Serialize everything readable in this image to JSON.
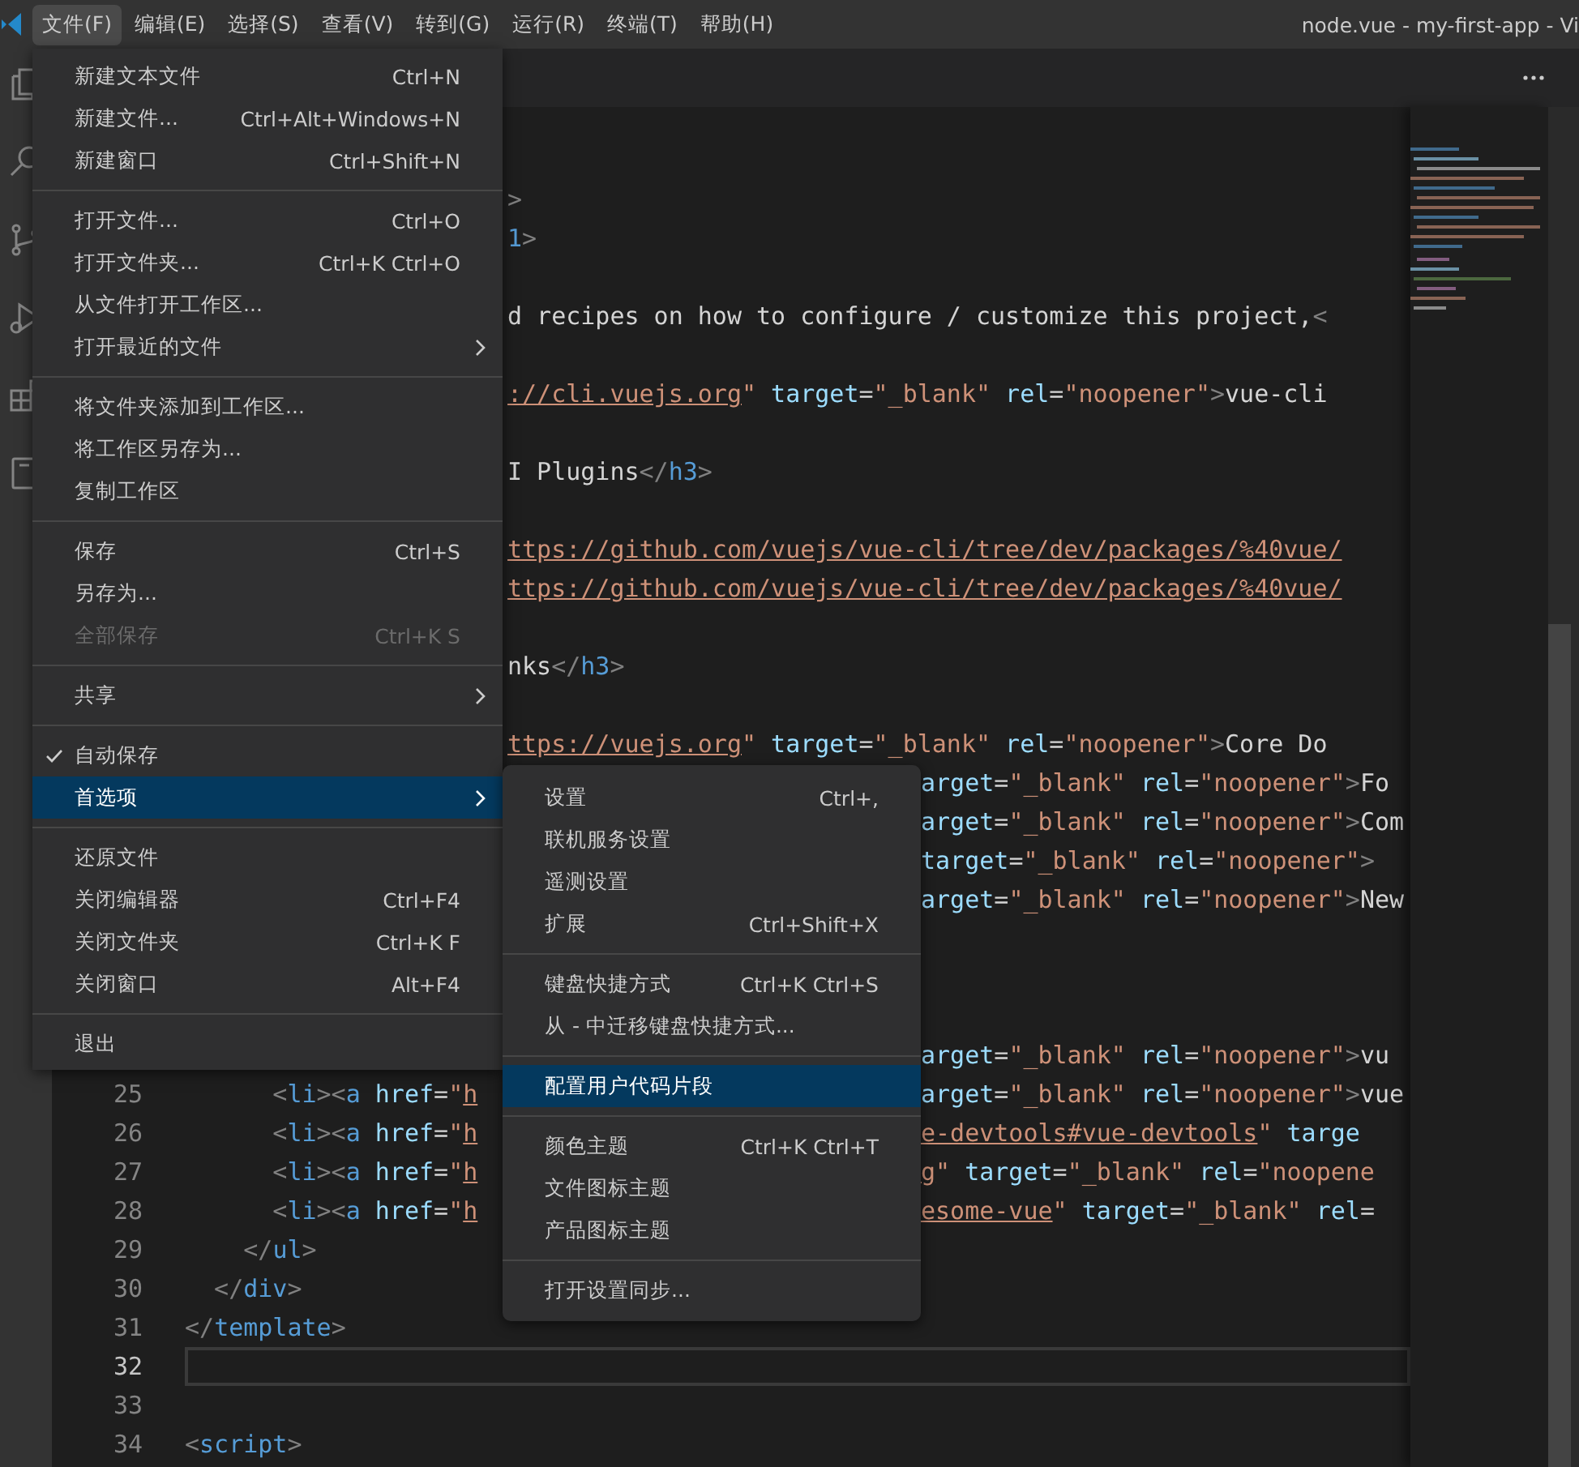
{
  "menu_bar": {
    "items": [
      {
        "label": "文件(F)",
        "selected": true
      },
      {
        "label": "编辑(E)",
        "selected": false
      },
      {
        "label": "选择(S)",
        "selected": false
      },
      {
        "label": "查看(V)",
        "selected": false
      },
      {
        "label": "转到(G)",
        "selected": false
      },
      {
        "label": "运行(R)",
        "selected": false
      },
      {
        "label": "终端(T)",
        "selected": false
      },
      {
        "label": "帮助(H)",
        "selected": false
      }
    ]
  },
  "window_title": "node.vue - my-first-app - Vi",
  "file_menu": {
    "items": [
      {
        "kind": "item",
        "label": "新建文本文件",
        "shortcut": "Ctrl+N",
        "has_submenu": false,
        "checked": false,
        "disabled": false,
        "selected": false
      },
      {
        "kind": "item",
        "label": "新建文件...",
        "shortcut": "Ctrl+Alt+Windows+N",
        "has_submenu": false,
        "checked": false,
        "disabled": false,
        "selected": false
      },
      {
        "kind": "item",
        "label": "新建窗口",
        "shortcut": "Ctrl+Shift+N",
        "has_submenu": false,
        "checked": false,
        "disabled": false,
        "selected": false
      },
      {
        "kind": "separator"
      },
      {
        "kind": "item",
        "label": "打开文件...",
        "shortcut": "Ctrl+O",
        "has_submenu": false,
        "checked": false,
        "disabled": false,
        "selected": false
      },
      {
        "kind": "item",
        "label": "打开文件夹...",
        "shortcut": "Ctrl+K Ctrl+O",
        "has_submenu": false,
        "checked": false,
        "disabled": false,
        "selected": false
      },
      {
        "kind": "item",
        "label": "从文件打开工作区...",
        "has_submenu": false,
        "checked": false,
        "disabled": false,
        "selected": false
      },
      {
        "kind": "item",
        "label": "打开最近的文件",
        "has_submenu": true,
        "checked": false,
        "disabled": false,
        "selected": false
      },
      {
        "kind": "separator"
      },
      {
        "kind": "item",
        "label": "将文件夹添加到工作区...",
        "has_submenu": false,
        "checked": false,
        "disabled": false,
        "selected": false
      },
      {
        "kind": "item",
        "label": "将工作区另存为...",
        "has_submenu": false,
        "checked": false,
        "disabled": false,
        "selected": false
      },
      {
        "kind": "item",
        "label": "复制工作区",
        "has_submenu": false,
        "checked": false,
        "disabled": false,
        "selected": false
      },
      {
        "kind": "separator"
      },
      {
        "kind": "item",
        "label": "保存",
        "shortcut": "Ctrl+S",
        "has_submenu": false,
        "checked": false,
        "disabled": false,
        "selected": false
      },
      {
        "kind": "item",
        "label": "另存为...",
        "has_submenu": false,
        "checked": false,
        "disabled": false,
        "selected": false
      },
      {
        "kind": "item",
        "label": "全部保存",
        "shortcut": "Ctrl+K S",
        "has_submenu": false,
        "checked": false,
        "disabled": true,
        "selected": false
      },
      {
        "kind": "separator"
      },
      {
        "kind": "item",
        "label": "共享",
        "has_submenu": true,
        "checked": false,
        "disabled": false,
        "selected": false
      },
      {
        "kind": "separator"
      },
      {
        "kind": "item",
        "label": "自动保存",
        "has_submenu": false,
        "checked": true,
        "disabled": false,
        "selected": false
      },
      {
        "kind": "item",
        "label": "首选项",
        "has_submenu": true,
        "checked": false,
        "disabled": false,
        "selected": true
      },
      {
        "kind": "separator"
      },
      {
        "kind": "item",
        "label": "还原文件",
        "has_submenu": false,
        "checked": false,
        "disabled": false,
        "selected": false
      },
      {
        "kind": "item",
        "label": "关闭编辑器",
        "shortcut": "Ctrl+F4",
        "has_submenu": false,
        "checked": false,
        "disabled": false,
        "selected": false
      },
      {
        "kind": "item",
        "label": "关闭文件夹",
        "shortcut": "Ctrl+K F",
        "has_submenu": false,
        "checked": false,
        "disabled": false,
        "selected": false
      },
      {
        "kind": "item",
        "label": "关闭窗口",
        "shortcut": "Alt+F4",
        "has_submenu": false,
        "checked": false,
        "disabled": false,
        "selected": false
      },
      {
        "kind": "separator"
      },
      {
        "kind": "item",
        "label": "退出",
        "has_submenu": false,
        "checked": false,
        "disabled": false,
        "selected": false
      }
    ]
  },
  "preferences_submenu": {
    "items": [
      {
        "kind": "item",
        "label": "设置",
        "shortcut": "Ctrl+,",
        "has_submenu": false,
        "checked": false,
        "disabled": false,
        "selected": false
      },
      {
        "kind": "item",
        "label": "联机服务设置",
        "has_submenu": false,
        "checked": false,
        "disabled": false,
        "selected": false
      },
      {
        "kind": "item",
        "label": "遥测设置",
        "has_submenu": false,
        "checked": false,
        "disabled": false,
        "selected": false
      },
      {
        "kind": "item",
        "label": "扩展",
        "shortcut": "Ctrl+Shift+X",
        "has_submenu": false,
        "checked": false,
        "disabled": false,
        "selected": false
      },
      {
        "kind": "separator"
      },
      {
        "kind": "item",
        "label": "键盘快捷方式",
        "shortcut": "Ctrl+K Ctrl+S",
        "has_submenu": false,
        "checked": false,
        "disabled": false,
        "selected": false
      },
      {
        "kind": "item",
        "label": "从 - 中迁移键盘快捷方式...",
        "has_submenu": false,
        "checked": false,
        "disabled": false,
        "selected": false
      },
      {
        "kind": "separator"
      },
      {
        "kind": "item",
        "label": "配置用户代码片段",
        "has_submenu": false,
        "checked": false,
        "disabled": false,
        "selected": true
      },
      {
        "kind": "separator"
      },
      {
        "kind": "item",
        "label": "颜色主题",
        "shortcut": "Ctrl+K Ctrl+T",
        "has_submenu": false,
        "checked": false,
        "disabled": false,
        "selected": false
      },
      {
        "kind": "item",
        "label": "文件图标主题",
        "has_submenu": false,
        "checked": false,
        "disabled": false,
        "selected": false
      },
      {
        "kind": "item",
        "label": "产品图标主题",
        "has_submenu": false,
        "checked": false,
        "disabled": false,
        "selected": false
      },
      {
        "kind": "separator"
      },
      {
        "kind": "item",
        "label": "打开设置同步...",
        "has_submenu": false,
        "checked": false,
        "disabled": false,
        "selected": false
      }
    ]
  },
  "editor": {
    "lines": [
      {
        "current": false
      },
      {
        "current": false,
        "left": [
          {
            "kind": "punct",
            "text": ">"
          }
        ]
      },
      {
        "current": false,
        "left": [
          {
            "kind": "tag",
            "text": "1"
          },
          {
            "kind": "punct",
            "text": ">"
          }
        ]
      },
      {
        "current": false
      },
      {
        "current": false,
        "left": [
          {
            "kind": "text",
            "text": "d recipes on how to configure / customize this project,"
          },
          {
            "kind": "punct",
            "text": "<"
          }
        ]
      },
      {
        "current": false
      },
      {
        "current": false,
        "left": [
          {
            "kind": "link",
            "text": "://cli.vuejs.org"
          },
          {
            "kind": "string",
            "text": "\""
          },
          {
            "kind": "attr",
            "text": " target"
          },
          {
            "kind": "text",
            "text": "="
          },
          {
            "kind": "string",
            "text": "\"_blank\""
          },
          {
            "kind": "attr",
            "text": " rel"
          },
          {
            "kind": "text",
            "text": "="
          },
          {
            "kind": "string",
            "text": "\"noopener\""
          },
          {
            "kind": "punct",
            "text": ">"
          },
          {
            "kind": "text",
            "text": "vue-cli"
          }
        ]
      },
      {
        "current": false
      },
      {
        "current": false,
        "left": [
          {
            "kind": "text",
            "text": "I Plugins"
          },
          {
            "kind": "punct",
            "text": "</"
          },
          {
            "kind": "tag",
            "text": "h3"
          },
          {
            "kind": "punct",
            "text": ">"
          }
        ]
      },
      {
        "current": false
      },
      {
        "current": false,
        "left": [
          {
            "kind": "link",
            "text": "ttps://github.com/vuejs/vue-cli/tree/dev/packages/%40vue/"
          }
        ]
      },
      {
        "current": false,
        "left": [
          {
            "kind": "link",
            "text": "ttps://github.com/vuejs/vue-cli/tree/dev/packages/%40vue/"
          }
        ]
      },
      {
        "current": false
      },
      {
        "current": false,
        "left": [
          {
            "kind": "text",
            "text": "nks"
          },
          {
            "kind": "punct",
            "text": "</"
          },
          {
            "kind": "tag",
            "text": "h3"
          },
          {
            "kind": "punct",
            "text": ">"
          }
        ]
      },
      {
        "current": false
      },
      {
        "current": false,
        "left": [
          {
            "kind": "link",
            "text": "ttps://vuejs.org"
          },
          {
            "kind": "string",
            "text": "\""
          },
          {
            "kind": "attr",
            "text": " target"
          },
          {
            "kind": "text",
            "text": "="
          },
          {
            "kind": "string",
            "text": "\"_blank\""
          },
          {
            "kind": "attr",
            "text": " rel"
          },
          {
            "kind": "text",
            "text": "="
          },
          {
            "kind": "string",
            "text": "\"noopener\""
          },
          {
            "kind": "punct",
            "text": ">"
          },
          {
            "kind": "text",
            "text": "Core Do"
          }
        ]
      },
      {
        "current": false,
        "right": [
          {
            "kind": "attr",
            "text": "arget"
          },
          {
            "kind": "text",
            "text": "="
          },
          {
            "kind": "string",
            "text": "\"_blank\""
          },
          {
            "kind": "attr",
            "text": " rel"
          },
          {
            "kind": "text",
            "text": "="
          },
          {
            "kind": "string",
            "text": "\"noopener\""
          },
          {
            "kind": "punct",
            "text": ">"
          },
          {
            "kind": "text",
            "text": "Fo"
          }
        ]
      },
      {
        "current": false,
        "right": [
          {
            "kind": "attr",
            "text": "arget"
          },
          {
            "kind": "text",
            "text": "="
          },
          {
            "kind": "string",
            "text": "\"_blank\""
          },
          {
            "kind": "attr",
            "text": " rel"
          },
          {
            "kind": "text",
            "text": "="
          },
          {
            "kind": "string",
            "text": "\"noopener\""
          },
          {
            "kind": "punct",
            "text": ">"
          },
          {
            "kind": "text",
            "text": "Com"
          }
        ]
      },
      {
        "current": false,
        "right": [
          {
            "kind": "attr",
            "text": "target"
          },
          {
            "kind": "text",
            "text": "="
          },
          {
            "kind": "string",
            "text": "\"_blank\""
          },
          {
            "kind": "attr",
            "text": " rel"
          },
          {
            "kind": "text",
            "text": "="
          },
          {
            "kind": "string",
            "text": "\"noopener\""
          },
          {
            "kind": "punct",
            "text": ">"
          }
        ]
      },
      {
        "current": false,
        "right": [
          {
            "kind": "attr",
            "text": "arget"
          },
          {
            "kind": "text",
            "text": "="
          },
          {
            "kind": "string",
            "text": "\"_blank\""
          },
          {
            "kind": "attr",
            "text": " rel"
          },
          {
            "kind": "text",
            "text": "="
          },
          {
            "kind": "string",
            "text": "\"noopener\""
          },
          {
            "kind": "punct",
            "text": ">"
          },
          {
            "kind": "text",
            "text": "New"
          }
        ]
      },
      {
        "current": false
      },
      {
        "current": false
      },
      {
        "current": false
      },
      {
        "current": false,
        "right": [
          {
            "kind": "attr",
            "text": "arget"
          },
          {
            "kind": "text",
            "text": "="
          },
          {
            "kind": "string",
            "text": "\"_blank\""
          },
          {
            "kind": "attr",
            "text": " rel"
          },
          {
            "kind": "text",
            "text": "="
          },
          {
            "kind": "string",
            "text": "\"noopener\""
          },
          {
            "kind": "punct",
            "text": ">"
          },
          {
            "kind": "text",
            "text": "vu"
          }
        ]
      },
      {
        "number": "25",
        "current": false,
        "left": [
          {
            "kind": "punct",
            "text": "      <"
          },
          {
            "kind": "tag",
            "text": "li"
          },
          {
            "kind": "punct",
            "text": "><"
          },
          {
            "kind": "tag",
            "text": "a"
          },
          {
            "kind": "attr",
            "text": " href"
          },
          {
            "kind": "text",
            "text": "="
          },
          {
            "kind": "string",
            "text": "\""
          },
          {
            "kind": "link",
            "text": "h"
          }
        ],
        "right": [
          {
            "kind": "attr",
            "text": "arget"
          },
          {
            "kind": "text",
            "text": "="
          },
          {
            "kind": "string",
            "text": "\"_blank\""
          },
          {
            "kind": "attr",
            "text": " rel"
          },
          {
            "kind": "text",
            "text": "="
          },
          {
            "kind": "string",
            "text": "\"noopener\""
          },
          {
            "kind": "punct",
            "text": ">"
          },
          {
            "kind": "text",
            "text": "vue"
          }
        ]
      },
      {
        "number": "26",
        "current": false,
        "left": [
          {
            "kind": "punct",
            "text": "      <"
          },
          {
            "kind": "tag",
            "text": "li"
          },
          {
            "kind": "punct",
            "text": "><"
          },
          {
            "kind": "tag",
            "text": "a"
          },
          {
            "kind": "attr",
            "text": " href"
          },
          {
            "kind": "text",
            "text": "="
          },
          {
            "kind": "string",
            "text": "\""
          },
          {
            "kind": "link",
            "text": "h"
          }
        ],
        "right": [
          {
            "kind": "link",
            "text": "e-devtools#vue-devtools"
          },
          {
            "kind": "string",
            "text": "\""
          },
          {
            "kind": "attr",
            "text": " targe"
          }
        ]
      },
      {
        "number": "27",
        "current": false,
        "left": [
          {
            "kind": "punct",
            "text": "      <"
          },
          {
            "kind": "tag",
            "text": "li"
          },
          {
            "kind": "punct",
            "text": "><"
          },
          {
            "kind": "tag",
            "text": "a"
          },
          {
            "kind": "attr",
            "text": " href"
          },
          {
            "kind": "text",
            "text": "="
          },
          {
            "kind": "string",
            "text": "\""
          },
          {
            "kind": "link",
            "text": "h"
          }
        ],
        "right": [
          {
            "kind": "link",
            "text": "g"
          },
          {
            "kind": "string",
            "text": "\""
          },
          {
            "kind": "attr",
            "text": " target"
          },
          {
            "kind": "text",
            "text": "="
          },
          {
            "kind": "string",
            "text": "\"_blank\""
          },
          {
            "kind": "attr",
            "text": " rel"
          },
          {
            "kind": "text",
            "text": "="
          },
          {
            "kind": "string",
            "text": "\"noopene"
          }
        ]
      },
      {
        "number": "28",
        "current": false,
        "left": [
          {
            "kind": "punct",
            "text": "      <"
          },
          {
            "kind": "tag",
            "text": "li"
          },
          {
            "kind": "punct",
            "text": "><"
          },
          {
            "kind": "tag",
            "text": "a"
          },
          {
            "kind": "attr",
            "text": " href"
          },
          {
            "kind": "text",
            "text": "="
          },
          {
            "kind": "string",
            "text": "\""
          },
          {
            "kind": "link",
            "text": "h"
          }
        ],
        "right": [
          {
            "kind": "link",
            "text": "esome-vue"
          },
          {
            "kind": "string",
            "text": "\""
          },
          {
            "kind": "attr",
            "text": " target"
          },
          {
            "kind": "text",
            "text": "="
          },
          {
            "kind": "string",
            "text": "\"_blank\""
          },
          {
            "kind": "attr",
            "text": " rel"
          },
          {
            "kind": "text",
            "text": "="
          }
        ]
      },
      {
        "number": "29",
        "current": false,
        "left": [
          {
            "kind": "punct",
            "text": "    </"
          },
          {
            "kind": "tag",
            "text": "ul"
          },
          {
            "kind": "punct",
            "text": ">"
          }
        ]
      },
      {
        "number": "30",
        "current": false,
        "left": [
          {
            "kind": "punct",
            "text": "  </"
          },
          {
            "kind": "tag",
            "text": "div"
          },
          {
            "kind": "punct",
            "text": ">"
          }
        ]
      },
      {
        "number": "31",
        "current": false,
        "left": [
          {
            "kind": "punct",
            "text": "</"
          },
          {
            "kind": "tag",
            "text": "template"
          },
          {
            "kind": "punct",
            "text": ">"
          }
        ]
      },
      {
        "number": "32",
        "current": true
      },
      {
        "number": "33",
        "current": false
      },
      {
        "number": "34",
        "current": false,
        "left": [
          {
            "kind": "punct",
            "text": "<"
          },
          {
            "kind": "tag",
            "text": "script"
          },
          {
            "kind": "punct",
            "text": ">"
          }
        ]
      }
    ]
  }
}
